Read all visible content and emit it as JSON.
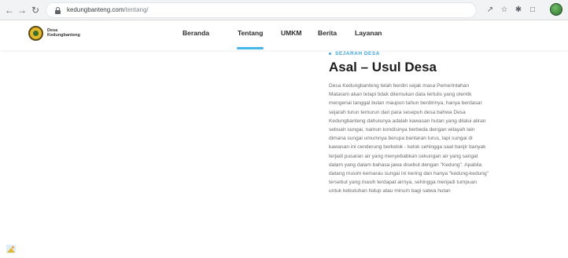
{
  "browser": {
    "url_domain": "kedungbanteng.com",
    "url_path": "/tentang/",
    "icons": [
      "back-icon",
      "forward-icon",
      "reload-icon",
      "lock-icon",
      "share-icon",
      "bookmark-star-icon",
      "extensions-icon",
      "side-panel-icon",
      "profile-avatar"
    ]
  },
  "site": {
    "logo_line1": "Desa",
    "logo_line2": "Kedungbanteng",
    "nav": {
      "beranda": "Beranda",
      "tentang": "Tentang",
      "umkm": "UMKM",
      "berita": "Berita",
      "layanan": "Layanan"
    },
    "active_nav": "Tentang",
    "accent_color": "#43b7e8"
  },
  "content": {
    "eyebrow": "SEJARAH DESA",
    "title": "Asal – Usul Desa",
    "lines": [
      "Desa Kedungbanteng telah berdiri sejak masa Pemerintahan",
      "Mataram akan tetapi tidak ditemukan data tertulis yang otentik",
      "mengenai tanggal bulan maupun tahun berdirinya, hanya berdasar",
      "sejarah turun temurun dari para sesepuh desa bahwa Desa",
      "Kedungbanteng dahulunya adalah kawasan hutan yang dilalui aliran",
      "sebuah sungai, namun kondisinya berbeda dengan wilayah lain",
      "dimana sungai umumnya berupa bantaran lurus, tapi sungai di",
      "kawasan ini cenderung berkelok - kelok sehingga saat banjir banyak",
      "terjadi pusaran air yang menyebabkan cekungan air yang sangat",
      "dalam yang dalam bahasa jawa disebut dengan \"Kedung\". Apabila",
      "datang musim kemarau sungai ini kering dan hanya \"kedung-kedung\"",
      "tersebut yang masih terdapat airnya, sehingga menjadi tumpuan",
      "untuk kebutuhan hidup atau minum bagi satwa hutan"
    ]
  }
}
